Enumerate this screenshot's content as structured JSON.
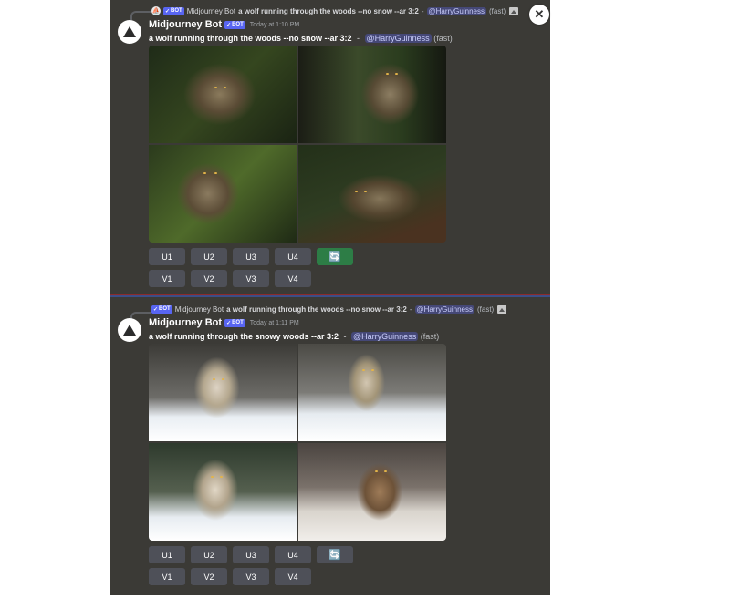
{
  "messages": [
    {
      "reply": {
        "bot_tag": "BOT",
        "bot_name": "Midjourney Bot",
        "prompt": "a wolf running through the woods --no snow --ar 3:2",
        "dash": "-",
        "mention": "@HarryGuinness",
        "speed": "(fast)"
      },
      "author": "Midjourney Bot",
      "bot_tag": "BOT",
      "timestamp": "Today at 1:10 PM",
      "prompt": "a wolf running through the woods --no snow --ar 3:2",
      "dash": "-",
      "mention": "@HarryGuinness",
      "speed": "(fast)",
      "upscale_buttons": [
        "U1",
        "U2",
        "U3",
        "U4"
      ],
      "variation_buttons": [
        "V1",
        "V2",
        "V3",
        "V4"
      ],
      "refresh_icon": "refresh-icon",
      "refresh_active": true
    },
    {
      "reply": {
        "bot_tag": "BOT",
        "bot_name": "Midjourney Bot",
        "prompt": "a wolf running through the woods --no snow --ar 3:2",
        "dash": "-",
        "mention": "@HarryGuinness",
        "speed": "(fast)"
      },
      "author": "Midjourney Bot",
      "bot_tag": "BOT",
      "timestamp": "Today at 1:11 PM",
      "prompt": "a wolf running through the snowy woods --ar 3:2",
      "dash": "-",
      "mention": "@HarryGuinness",
      "speed": "(fast)",
      "upscale_buttons": [
        "U1",
        "U2",
        "U3",
        "U4"
      ],
      "variation_buttons": [
        "V1",
        "V2",
        "V3",
        "V4"
      ],
      "refresh_icon": "refresh-icon",
      "refresh_active": false
    }
  ],
  "colors": {
    "panel_bg": "#3b3a36",
    "button_bg": "#4e5058",
    "button_active_bg": "#2d7d46",
    "bot_tag": "#5865f2",
    "mention_text": "#c9cdfb"
  },
  "close_icon": "close-icon"
}
